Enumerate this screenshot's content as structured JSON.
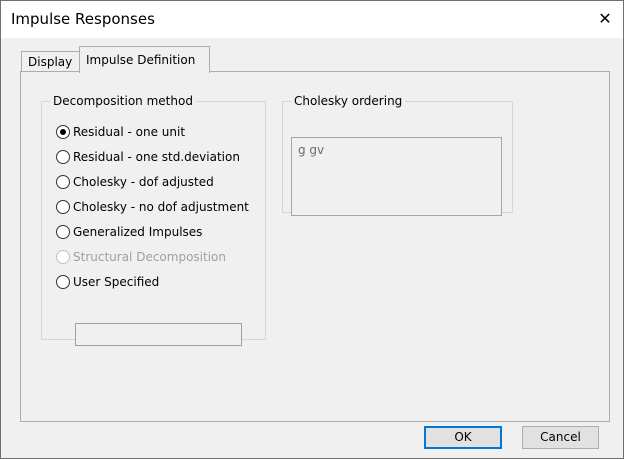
{
  "window": {
    "title": "Impulse Responses",
    "close_label": "✕"
  },
  "tabs": [
    {
      "label": "Display"
    },
    {
      "label": "Impulse Definition"
    }
  ],
  "decomposition": {
    "legend": "Decomposition method",
    "options": [
      {
        "label": "Residual - one unit",
        "selected": true
      },
      {
        "label": "Residual - one std.deviation"
      },
      {
        "label": "Cholesky - dof adjusted"
      },
      {
        "label": "Cholesky - no dof adjustment"
      },
      {
        "label": "Generalized Impulses"
      },
      {
        "label": "Structural Decomposition",
        "disabled": true
      },
      {
        "label": "User Specified"
      }
    ]
  },
  "cholesky": {
    "legend": "Cholesky ordering",
    "value": "g gv"
  },
  "buttons": {
    "ok": "OK",
    "cancel": "Cancel"
  }
}
